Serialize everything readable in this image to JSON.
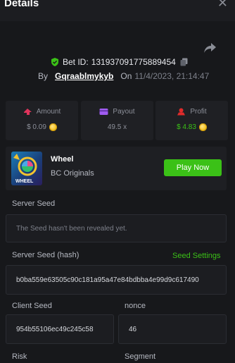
{
  "header": {
    "title": "Details",
    "close_icon": "close-icon"
  },
  "bet": {
    "bet_id_label": "Bet ID:",
    "bet_id": "131937091775889454",
    "by_label": "By",
    "user": "Gqraablmykyb",
    "on_label": "On",
    "date": "11/4/2023, 21:14:47"
  },
  "stats": {
    "amount": {
      "label": "Amount",
      "value": "$ 0.09"
    },
    "payout": {
      "label": "Payout",
      "value": "49.5 x"
    },
    "profit": {
      "label": "Profit",
      "value": "$ 4.83"
    }
  },
  "colors": {
    "accent": "#3bc117",
    "profit": "#3bc117",
    "amount_icon": "#e0345c",
    "payout_icon": "#a05cf0",
    "profit_icon": "#e02b2b"
  },
  "game": {
    "name": "Wheel",
    "provider": "BC Originals",
    "play_label": "Play Now",
    "thumb_text": "WHEEL"
  },
  "server_seed": {
    "label": "Server Seed",
    "value": "The Seed hasn't been revealed yet."
  },
  "server_seed_hash": {
    "label": "Server Seed (hash)",
    "settings_label": "Seed Settings",
    "value": "b0ba559e63505c90c181a95a47e84bdbba4e99d9c617490"
  },
  "client_seed": {
    "label": "Client Seed",
    "value": "954b55106ec49c245c58"
  },
  "nonce": {
    "label": "nonce",
    "value": "46"
  },
  "risk": {
    "label": "Risk"
  },
  "segment": {
    "label": "Segment"
  }
}
